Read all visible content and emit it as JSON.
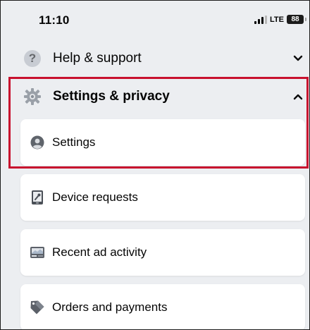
{
  "status_bar": {
    "time": "11:10",
    "network": "LTE",
    "battery": "88"
  },
  "menu": {
    "help": {
      "label": "Help & support",
      "icon": "question-circle-icon",
      "expanded": false
    },
    "settings_privacy": {
      "label": "Settings & privacy",
      "icon": "gear-icon",
      "expanded": true,
      "items": [
        {
          "label": "Settings",
          "icon": "user-circle-icon"
        },
        {
          "label": "Device requests",
          "icon": "phone-key-icon"
        },
        {
          "label": "Recent ad activity",
          "icon": "ad-card-icon"
        },
        {
          "label": "Orders and payments",
          "icon": "payment-tag-icon"
        }
      ]
    }
  },
  "colors": {
    "background": "#eceef1",
    "card": "#ffffff",
    "highlight": "#c8102e",
    "text": "#050505"
  }
}
